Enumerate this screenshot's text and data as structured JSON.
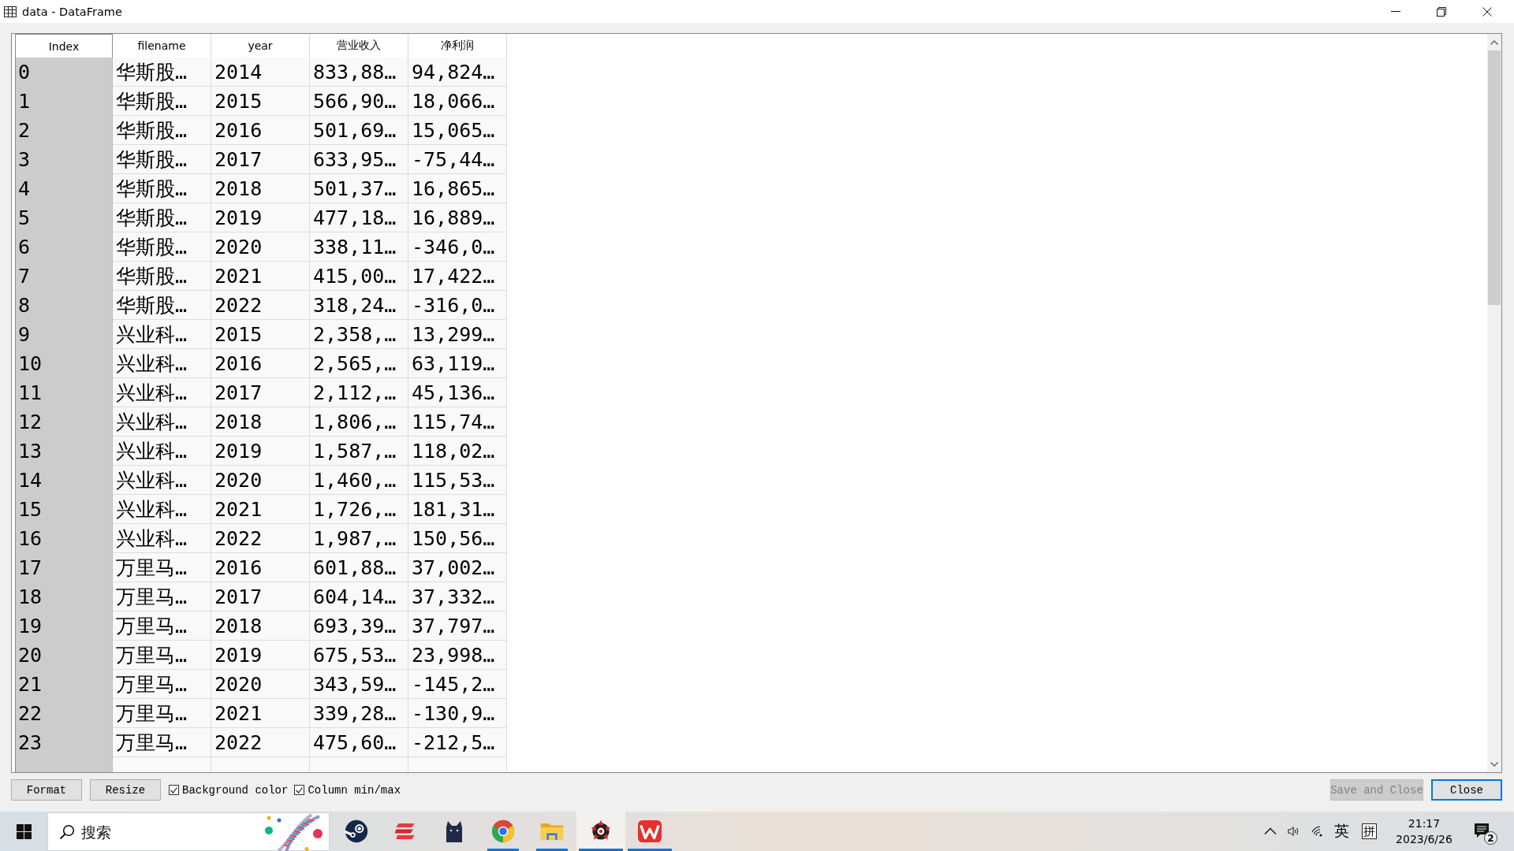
{
  "window": {
    "title": "data - DataFrame"
  },
  "table": {
    "columns": [
      "Index",
      "filename",
      "year",
      "营业收入",
      "净利润"
    ],
    "rows": [
      [
        "0",
        "华斯股…",
        "2014",
        "833,88…",
        "94,824…"
      ],
      [
        "1",
        "华斯股…",
        "2015",
        "566,90…",
        "18,066…"
      ],
      [
        "2",
        "华斯股…",
        "2016",
        "501,69…",
        "15,065…"
      ],
      [
        "3",
        "华斯股…",
        "2017",
        "633,95…",
        "-75,44…"
      ],
      [
        "4",
        "华斯股…",
        "2018",
        "501,37…",
        "16,865…"
      ],
      [
        "5",
        "华斯股…",
        "2019",
        "477,18…",
        "16,889…"
      ],
      [
        "6",
        "华斯股…",
        "2020",
        "338,11…",
        "-346,0…"
      ],
      [
        "7",
        "华斯股…",
        "2021",
        "415,00…",
        "17,422…"
      ],
      [
        "8",
        "华斯股…",
        "2022",
        "318,24…",
        "-316,0…"
      ],
      [
        "9",
        "兴业科…",
        "2015",
        "2,358,…",
        "13,299…"
      ],
      [
        "10",
        "兴业科…",
        "2016",
        "2,565,…",
        "63,119…"
      ],
      [
        "11",
        "兴业科…",
        "2017",
        "2,112,…",
        "45,136…"
      ],
      [
        "12",
        "兴业科…",
        "2018",
        "1,806,…",
        "115,74…"
      ],
      [
        "13",
        "兴业科…",
        "2019",
        "1,587,…",
        "118,02…"
      ],
      [
        "14",
        "兴业科…",
        "2020",
        "1,460,…",
        "115,53…"
      ],
      [
        "15",
        "兴业科…",
        "2021",
        "1,726,…",
        "181,31…"
      ],
      [
        "16",
        "兴业科…",
        "2022",
        "1,987,…",
        "150,56…"
      ],
      [
        "17",
        "万里马…",
        "2016",
        "601,88…",
        "37,002…"
      ],
      [
        "18",
        "万里马…",
        "2017",
        "604,14…",
        "37,332…"
      ],
      [
        "19",
        "万里马…",
        "2018",
        "693,39…",
        "37,797…"
      ],
      [
        "20",
        "万里马…",
        "2019",
        "675,53…",
        "23,998…"
      ],
      [
        "21",
        "万里马…",
        "2020",
        "343,59…",
        "-145,2…"
      ],
      [
        "22",
        "万里马…",
        "2021",
        "339,28…",
        "-130,9…"
      ],
      [
        "23",
        "万里马…",
        "2022",
        "475,60…",
        "-212,5…"
      ]
    ]
  },
  "footer": {
    "left_buttons": [
      "Format",
      "Resize"
    ],
    "options": [
      {
        "label": "Background color",
        "checked": true
      },
      {
        "label": "Column min/max",
        "checked": true
      }
    ],
    "right_buttons": [
      {
        "label": "Save and Close",
        "disabled": true,
        "focused": false
      },
      {
        "label": "Close",
        "disabled": false,
        "focused": true
      }
    ]
  },
  "taskbar": {
    "search": {
      "placeholder": "搜索"
    },
    "apps": [
      {
        "running": false,
        "active": false,
        "selected": false
      },
      {
        "running": false,
        "active": false,
        "selected": false
      },
      {
        "running": false,
        "active": false,
        "selected": false
      },
      {
        "running": true,
        "active": false,
        "selected": false
      },
      {
        "running": true,
        "active": false,
        "selected": false
      },
      {
        "running": true,
        "active": true,
        "selected": true
      },
      {
        "running": true,
        "active": true,
        "selected": false
      }
    ],
    "tray": {
      "language": "英",
      "ime": "拼",
      "time": "21:17",
      "date": "2023/6/26",
      "notifications": "2"
    }
  }
}
